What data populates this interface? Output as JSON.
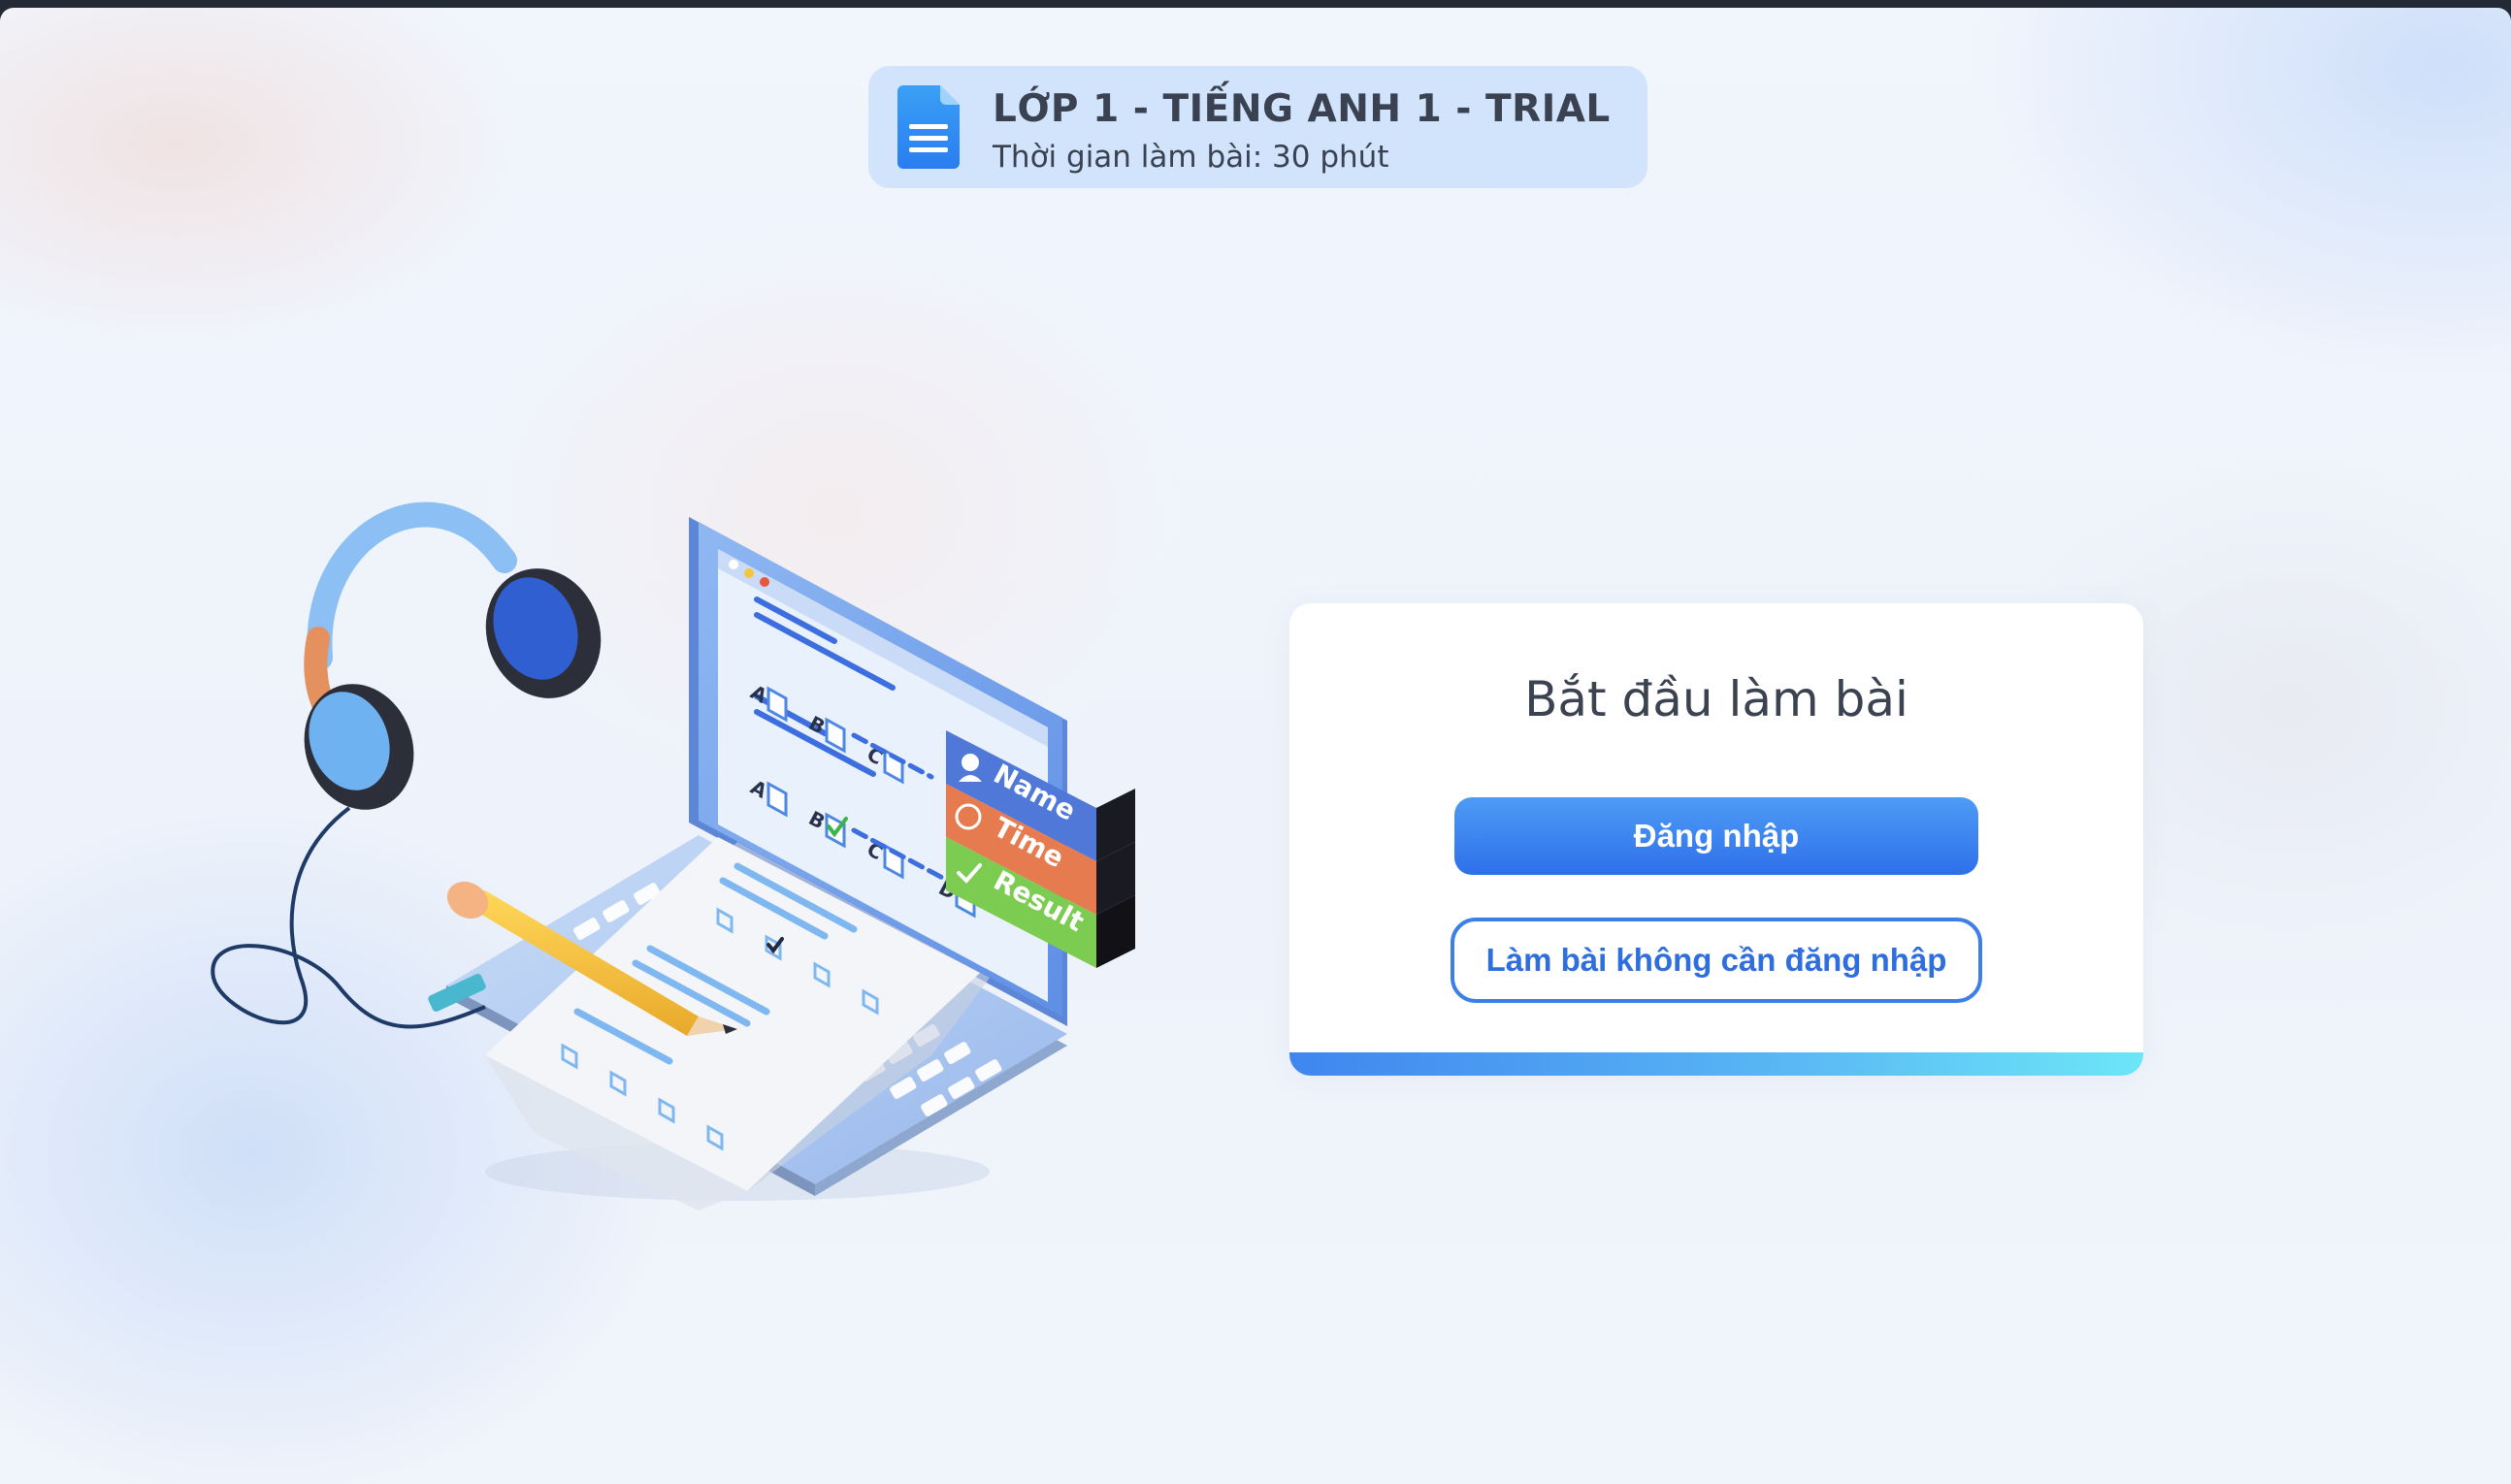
{
  "header": {
    "title": "LỚP 1 - TIẾNG ANH 1 - TRIAL",
    "subtitle": "Thời gian làm bài: 30 phút",
    "icon": "document-icon"
  },
  "illustration": {
    "labels": {
      "name": "Name",
      "time": "Time",
      "result": "Result"
    },
    "options": [
      "A",
      "B",
      "C",
      "D"
    ]
  },
  "card": {
    "title": "Bắt đầu làm bài",
    "login_label": "Đăng nhập",
    "guest_label": "Làm bài không cần đăng nhập"
  },
  "colors": {
    "primary": "#3d7fe6",
    "header_bg": "#d2e4fb",
    "text": "#3b4250"
  }
}
